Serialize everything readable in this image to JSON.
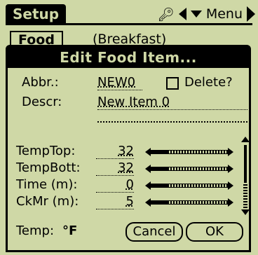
{
  "titlebar": {
    "title": "Setup",
    "menu_label": "Menu"
  },
  "background": {
    "field_button": "Food",
    "field_value": "(Breakfast)"
  },
  "dialog": {
    "title": "Edit Food Item...",
    "abbr_label": "Abbr.:",
    "abbr_value": "NEW0",
    "delete_label": "Delete?",
    "delete_checked": false,
    "descr_label": "Descr:",
    "descr_value": "New Item 0",
    "rows": [
      {
        "label": "TempTop:",
        "value": "32"
      },
      {
        "label": "TempBott:",
        "value": "32"
      },
      {
        "label": "Time (m):",
        "value": "0"
      },
      {
        "label": "CkMr (m):",
        "value": "5"
      }
    ],
    "temp_label": "Temp:",
    "temp_unit": "°F",
    "cancel_label": "Cancel",
    "ok_label": "OK"
  }
}
